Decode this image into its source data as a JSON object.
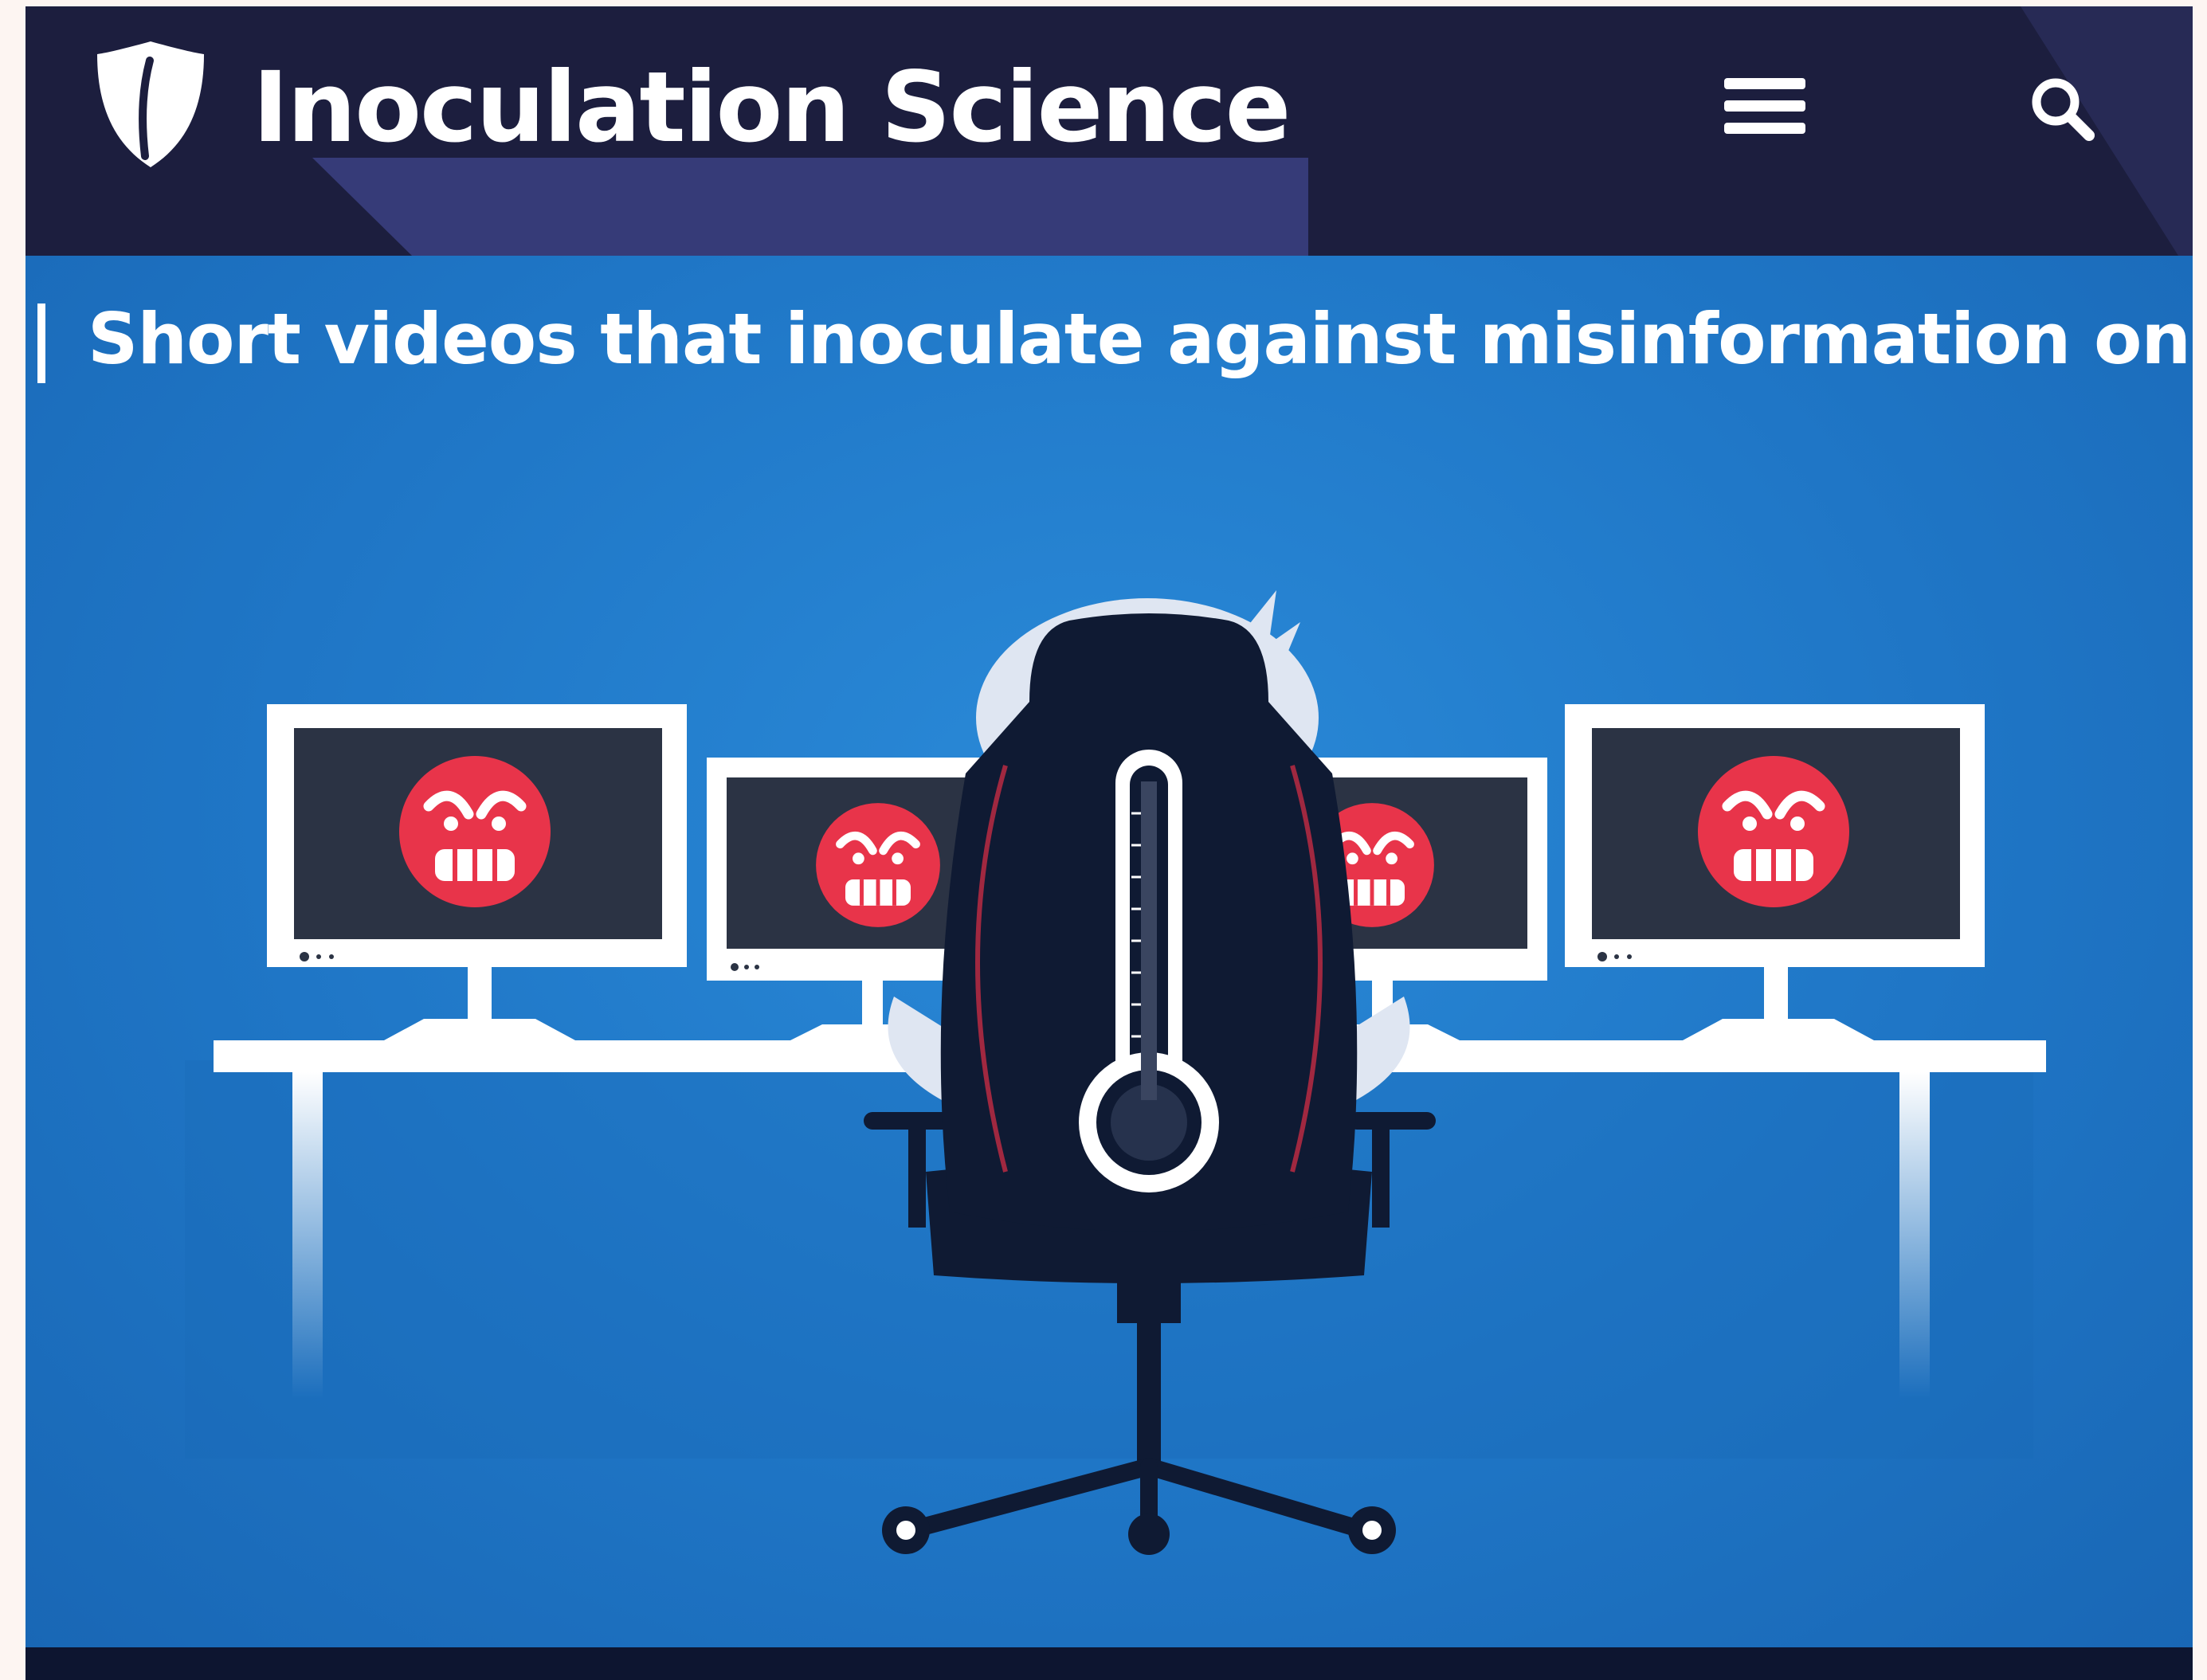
{
  "header": {
    "site_title": "Inoculation Science",
    "logo_icon": "shield-logo-icon",
    "menu_icon": "hamburger-menu-icon",
    "search_icon": "search-icon"
  },
  "hero": {
    "tagline": "Short videos that inoculate against misinformation online",
    "illustration": "person-in-chair-facing-monitors-illustration"
  },
  "colors": {
    "header_bg": "#1c1e3e",
    "header_accent": "#363b78",
    "hero_bg": "#1f76c6",
    "angry_face": "#e8344a",
    "chair": "#0f1a33",
    "bottom_strip": "#0d1530"
  }
}
